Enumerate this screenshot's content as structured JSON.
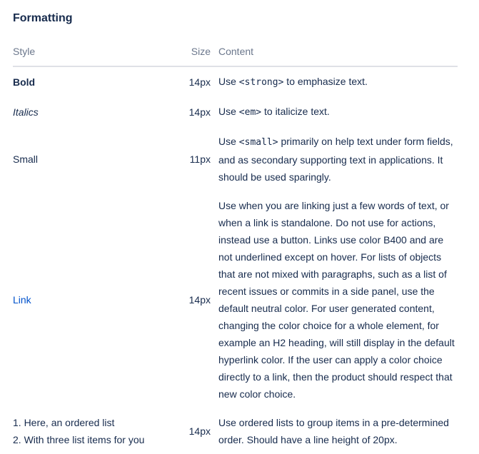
{
  "section": {
    "title": "Formatting"
  },
  "table": {
    "headers": {
      "style": "Style",
      "size": "Size",
      "content": "Content"
    },
    "rows": [
      {
        "style": "Bold",
        "size": "14px",
        "content_pre": "Use ",
        "content_code": "<strong>",
        "content_post": " to emphasize text."
      },
      {
        "style": "Italics",
        "size": "14px",
        "content_pre": "Use ",
        "content_code": "<em>",
        "content_post": " to italicize text."
      },
      {
        "style": "Small",
        "size": "11px",
        "content_pre": "Use ",
        "content_code": "<small>",
        "content_post": " primarily on help text under form fields, and as secondary supporting text in applications. It should be used sparingly."
      },
      {
        "style": "Link",
        "size": "14px",
        "content": "Use when you are linking just a few words of text, or when a link is standalone. Do not use for actions, instead use a button. Links use color B400 and are not underlined except on hover. For lists of objects that are not mixed with paragraphs, such as a list of recent issues or commits in a side panel, use the default neutral color. For user generated content, changing the color choice for a whole element, for example an H2 heading, will still display in the default hyperlink color. If the user can apply a color choice directly to a link, then the product should respect that new color choice."
      },
      {
        "style_items": [
          "1. Here, an ordered list",
          "2. With three list items for you"
        ],
        "size": "14px",
        "content": "Use ordered lists to group items in a pre-determined order. Should have a line height of 20px."
      }
    ]
  }
}
